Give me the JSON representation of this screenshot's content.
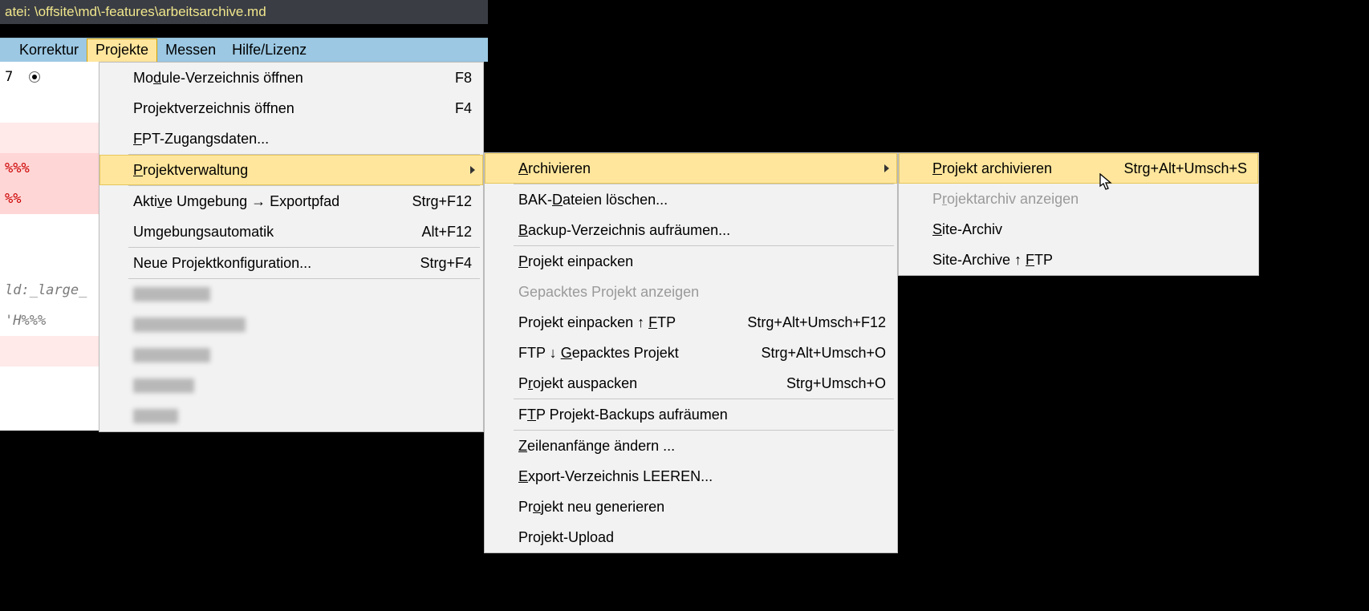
{
  "titlebar": {
    "prefix": "atei: ",
    "path": "\\offsite\\md\\-features\\arbeitsarchive.md"
  },
  "menubar": {
    "korrektur": "Korrektur",
    "projekte": "Projekte",
    "messen": "Messen",
    "hilfe": "Hilfe/Lizenz"
  },
  "menu1": {
    "module": "Module-Verzeichnis öffnen",
    "module_sc": "F8",
    "projverz": "Projektverzeichnis öffnen",
    "projverz_sc": "F4",
    "fpt": "FPT-Zugangsdaten...",
    "projverw": "Projektverwaltung",
    "aktive": "Aktive Umgebung → Exportpfad",
    "aktive_sc": "Strg+F12",
    "umgauto": "Umgebungsautomatik",
    "umgauto_sc": "Alt+F12",
    "neuekonf": "Neue Projektkonfiguration...",
    "neuekonf_sc": "Strg+F4"
  },
  "menu2": {
    "arch": "Archivieren",
    "bak": "BAK-Dateien löschen...",
    "backup": "Backup-Verzeichnis aufräumen...",
    "einpacken": "Projekt einpacken",
    "gepackt": "Gepacktes Projekt anzeigen",
    "einftp": "Projekt einpacken ↑ FTP",
    "einftp_sc": "Strg+Alt+Umsch+F12",
    "ftpdown": "FTP ↓ Gepacktes Projekt",
    "ftpdown_sc": "Strg+Alt+Umsch+O",
    "ausp": "Projekt auspacken",
    "ausp_sc": "Strg+Umsch+O",
    "ftpclean": "FTP Projekt-Backups aufräumen",
    "zeilen": "Zeilenanfänge ändern ...",
    "leeren": "Export-Verzeichnis LEEREN...",
    "neugen": "Projekt neu generieren",
    "upload": "Projekt-Upload"
  },
  "menu3": {
    "proj": "Projekt archivieren",
    "proj_sc": "Strg+Alt+Umsch+S",
    "anz": "Projektarchiv anzeigen",
    "site": "Site-Archiv",
    "siteftp": "Site-Archive ↑ FTP"
  },
  "editor": {
    "n7": "7",
    "pct1": "%%%",
    "pct2": "%%",
    "large": "ld:_large_",
    "ehpct": "'H%%%"
  },
  "blur_widths": [
    96,
    140,
    96,
    76,
    56
  ]
}
